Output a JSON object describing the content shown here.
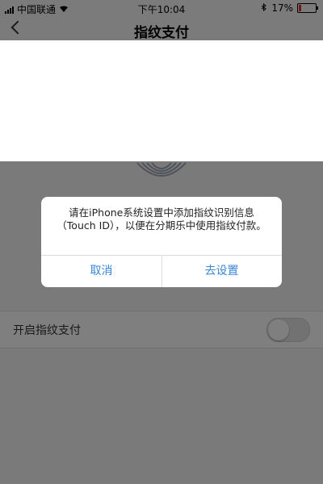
{
  "status_bar": {
    "carrier": "中国联通",
    "time": "下午10:04",
    "battery": "17%",
    "battery_level": 0.17
  },
  "nav": {
    "title": "指纹支付",
    "back_icon": "chevron-left-icon"
  },
  "settings": {
    "fingerprint_toggle_label": "开启指纹支付",
    "toggle_on": false
  },
  "alert": {
    "message": "请在iPhone系统设置中添加指纹识别信息（Touch ID），以便在分期乐中使用指纹付款。",
    "cancel_label": "取消",
    "settings_label": "去设置"
  },
  "colors": {
    "accent": "#3a86d6",
    "battery_low": "#e0322b",
    "overlay": "rgba(0,0,0,0.5)"
  }
}
